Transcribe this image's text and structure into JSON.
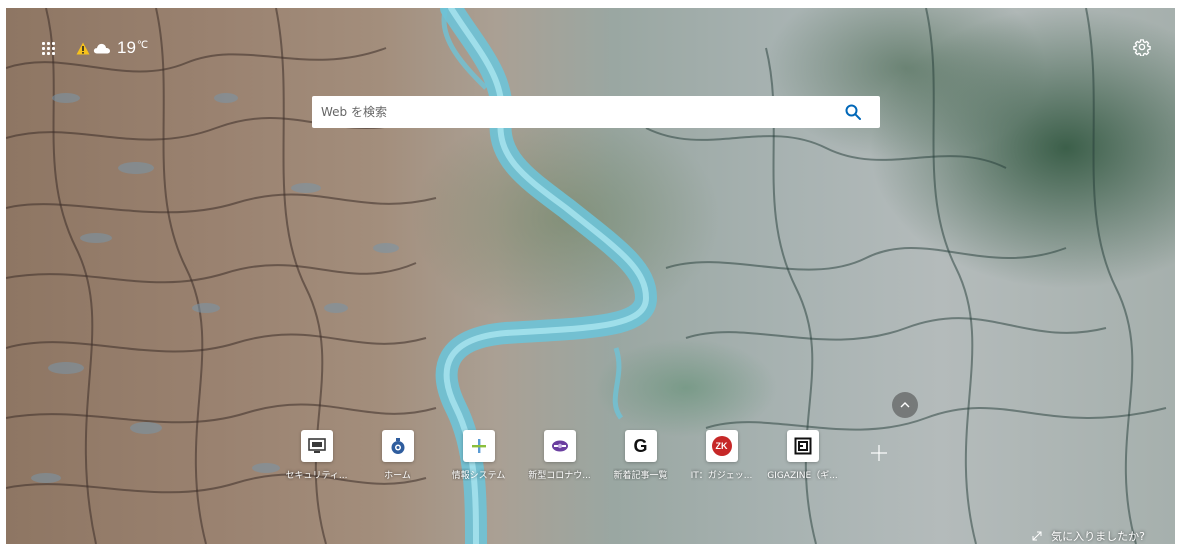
{
  "weather": {
    "temperature": "19",
    "unit": "℃",
    "alert_icon": "warning-triangle-icon",
    "condition_icon": "cloud-icon"
  },
  "search": {
    "placeholder": "Web を検索"
  },
  "quick_links": [
    {
      "label": "セキュリティ...",
      "icon": "monitor-icon",
      "color": "#3a3a3a"
    },
    {
      "label": "ホーム",
      "icon": "clock-badge-icon",
      "color": "#2f5d9e"
    },
    {
      "label": "情報システム",
      "icon": "plus-cross-icon",
      "color": "#5a9bd4"
    },
    {
      "label": "新型コロナウ...",
      "icon": "virus-icon",
      "color": "#6b3fa0"
    },
    {
      "label": "新着記事一覧",
      "icon": "g-letter-icon",
      "color": "#111111",
      "glyph": "G"
    },
    {
      "label": "IT：ガジェッ...",
      "icon": "zk-logo-icon",
      "color": "#c62828",
      "glyph": "ZK"
    },
    {
      "label": "GIGAZINE（ギ...",
      "icon": "square-logo-icon",
      "color": "#111111"
    }
  ],
  "feedback": {
    "label": "気に入りましたか?"
  },
  "colors": {
    "accent": "#0067b8"
  }
}
